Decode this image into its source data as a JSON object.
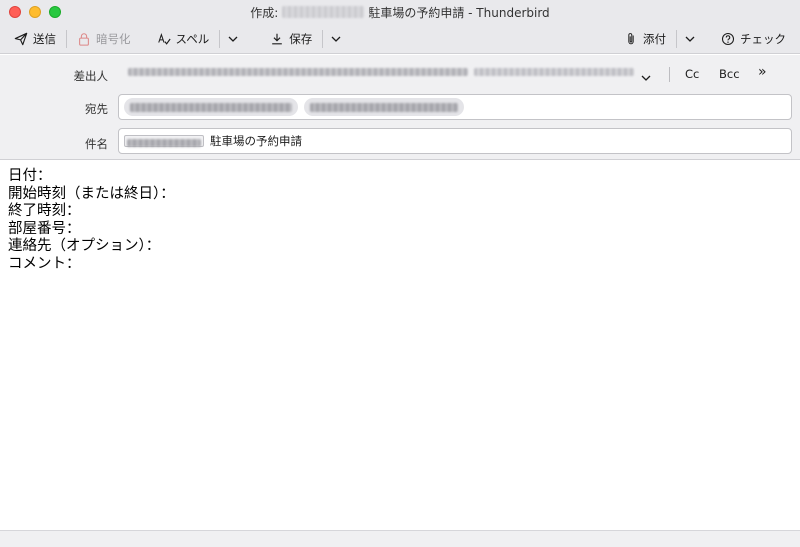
{
  "window": {
    "title_prefix": "作成:",
    "title_subject": "駐車場の予約申請 - Thunderbird",
    "title_blurred_tag": "[SANBANKAN]"
  },
  "toolbar": {
    "send_label": "送信",
    "encrypt_label": "暗号化",
    "spell_label": "スペル",
    "save_label": "保存",
    "attach_label": "添付",
    "check_label": "チェック"
  },
  "header": {
    "from_label": "差出人",
    "from_value": "[blurred sender address]",
    "cc_label": "Cc",
    "bcc_label": "Bcc",
    "more_label": "»",
    "to_label": "宛先",
    "to_recipients": [
      "[blurred recipient 1]",
      "[blurred recipient 2]"
    ],
    "subject_label": "件名",
    "subject_tag": "[SANBANKAN]",
    "subject_value": "駐車場の予約申請"
  },
  "body": {
    "lines": [
      "日付：",
      "開始時刻（または終日）：",
      "終了時刻：",
      "部屋番号：",
      "連絡先（オプション）：",
      "コメント："
    ]
  },
  "colors": {
    "chrome_bg": "#e9e9ec",
    "header_bg": "#f0f0f2",
    "close": "#ff5f57",
    "minimize": "#febc2e",
    "maximize": "#28c840"
  }
}
